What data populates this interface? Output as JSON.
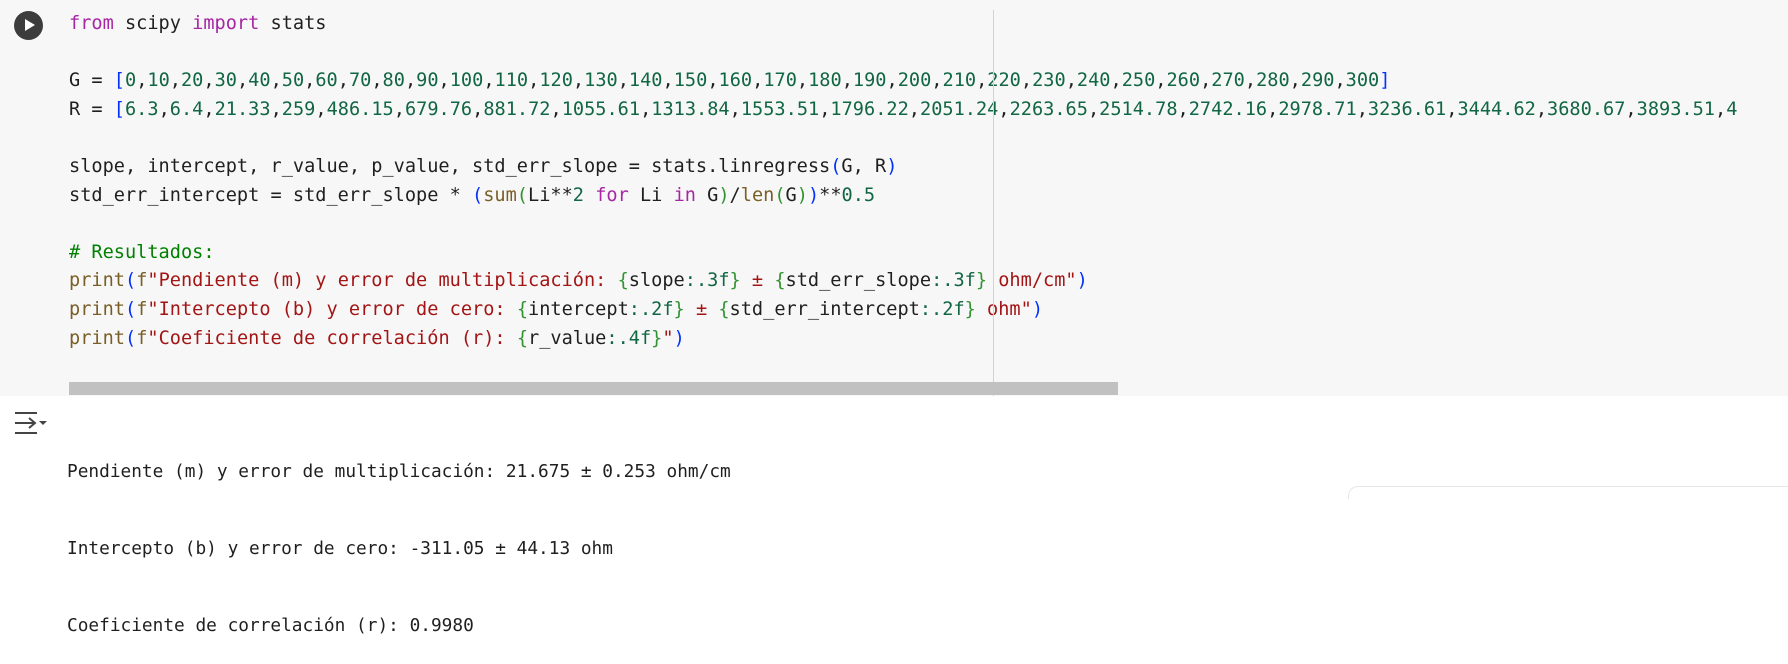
{
  "cell": {
    "code_lines": [
      "from scipy import stats",
      "",
      "G = [0,10,20,30,40,50,60,70,80,90,100,110,120,130,140,150,160,170,180,190,200,210,220,230,240,250,260,270,280,290,300]",
      "R = [6.3,6.4,21.33,259,486.15,679.76,881.72,1055.61,1313.84,1553.51,1796.22,2051.24,2263.65,2514.78,2742.16,2978.71,3236.61,3444.62,3680.67,3893.51,4",
      "",
      "slope, intercept, r_value, p_value, std_err_slope = stats.linregress(G, R)",
      "std_err_intercept = std_err_slope * (sum(Li**2 for Li in G)/len(G))**0.5",
      "",
      "# Resultados:",
      "print(f\"Pendiente (m) y error de multiplicación: {slope:.3f} ± {std_err_slope:.3f} ohm/cm\")",
      "print(f\"Intercepto (b) y error de cero: {intercept:.2f} ± {std_err_intercept:.2f} ohm\")",
      "print(f\"Coeficiente de correlación (r): {r_value:.4f}\")"
    ]
  },
  "output": {
    "lines": [
      "Pendiente (m) y error de multiplicación: 21.675 ± 0.253 ohm/cm",
      "Intercepto (b) y error de cero: -311.05 ± 44.13 ohm",
      "Coeficiente de correlación (r): 0.9980"
    ]
  },
  "icons": {
    "run": "play-icon",
    "output": "output-toggle-icon"
  },
  "colors": {
    "keyword": "#a626a4",
    "number": "#116644",
    "string": "#a31515",
    "comment": "#008000",
    "function": "#795e26"
  }
}
